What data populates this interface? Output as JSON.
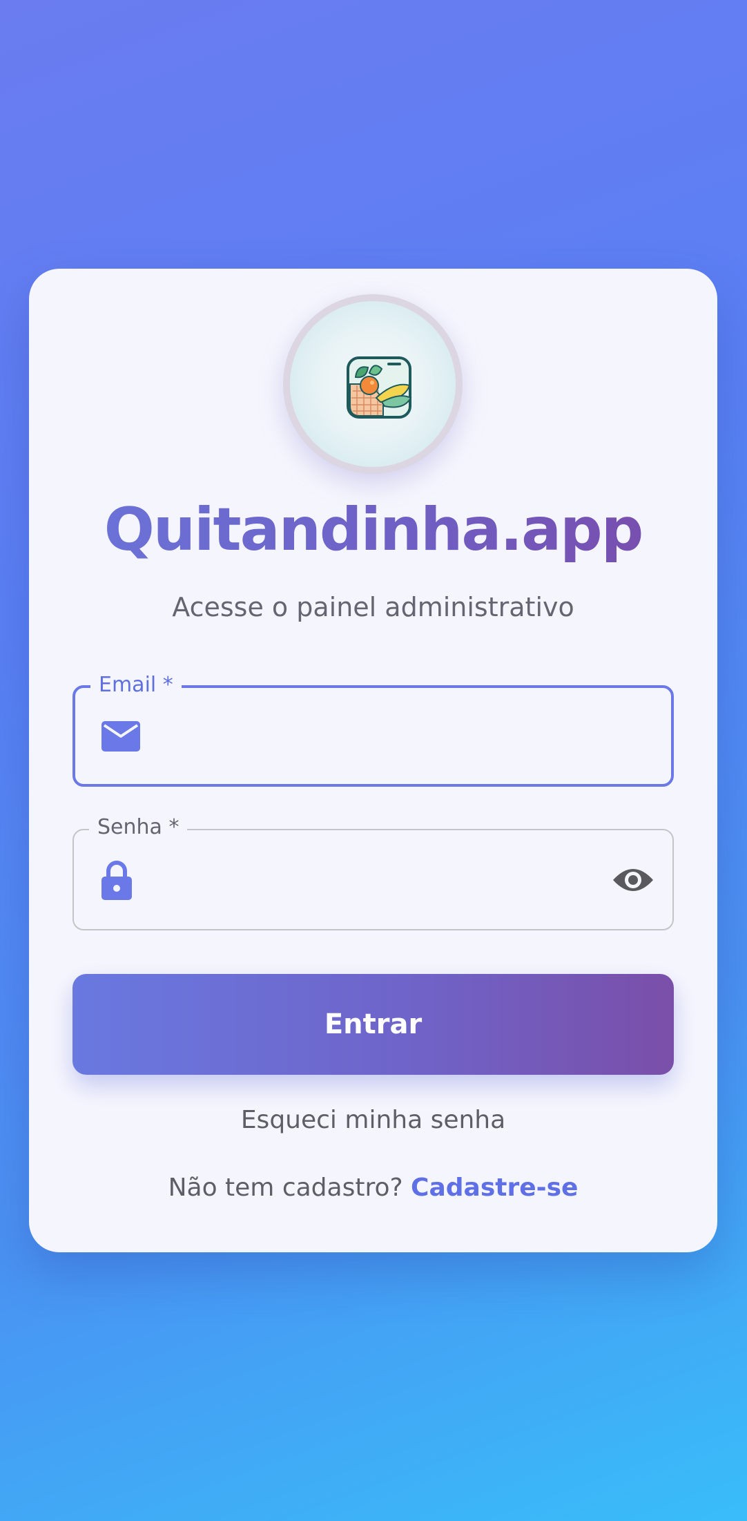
{
  "brand": {
    "logo_icon": "produce-basket-icon",
    "title": "Quitandinha.app",
    "subtitle": "Acesse o painel administrativo"
  },
  "form": {
    "email": {
      "label": "Email *",
      "value": "",
      "icon": "envelope-icon",
      "state": "focused"
    },
    "password": {
      "label": "Senha *",
      "value": "",
      "icon": "lock-icon",
      "toggle_icon": "eye-icon"
    },
    "submit_label": "Entrar"
  },
  "links": {
    "forgot_password": "Esqueci minha senha",
    "signup_prompt": "Não tem cadastro?",
    "signup_link": "Cadastre-se"
  },
  "colors": {
    "accent": "#6a78e8",
    "brand_purple": "#7a4aa8",
    "background_top": "#6a7cf0",
    "background_bottom": "#39bdf9",
    "card": "#f5f6fd"
  }
}
